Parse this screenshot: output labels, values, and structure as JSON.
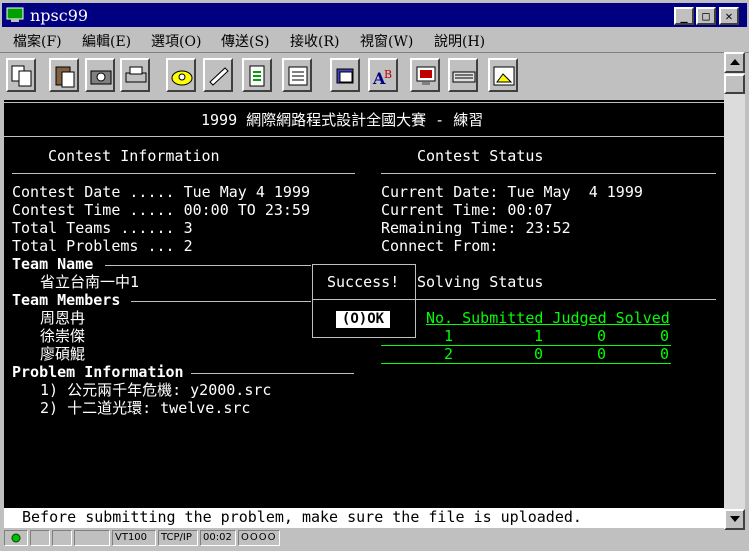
{
  "window": {
    "title": "npsc99"
  },
  "menu": [
    "檔案(F)",
    "編輯(E)",
    "選項(O)",
    "傳送(S)",
    "接收(R)",
    "視窗(W)",
    "說明(H)"
  ],
  "toolbar_icons": [
    "copy-icon",
    "paste-icon",
    "camera-icon",
    "print-icon",
    "phone-dial-icon",
    "hang-up-icon",
    "transfer-icon",
    "properties-icon",
    "send-file-icon",
    "receive-spell-icon",
    "monitor-icon",
    "keyboard-icon",
    "capture-icon"
  ],
  "terminal": {
    "header": "1999 網際網路程式設計全國大賽 - 練習",
    "contest_info": {
      "title": "Contest Information",
      "date": "Contest Date ..... Tue May 4 1999",
      "time": "Contest Time ..... 00:00 TO 23:59",
      "teams": "Total Teams ...... 3",
      "problems": "Total Problems ... 2"
    },
    "contest_status": {
      "title": "Contest Status",
      "current_date": "Current Date: Tue May  4 1999",
      "current_time": "Current Time: 00:07",
      "remaining": "Remaining Time: 23:52",
      "connect": "Connect From:"
    },
    "team_name_label": "Team Name",
    "team_name": "省立台南一中1",
    "team_members_label": "Team Members",
    "members": [
      "周恩冉",
      "徐崇傑",
      "廖碩鯤"
    ],
    "problem_info_label": "Problem Information",
    "problems": [
      "1) 公元兩千年危機: y2000.src",
      "2) 十二道光環: twelve.src"
    ],
    "solving_status_title": "Solving Status",
    "table_header": "No. Submitted Judged Solved",
    "table_rows": [
      {
        "no": "1",
        "submitted": "1",
        "judged": "0",
        "solved": "0"
      },
      {
        "no": "2",
        "submitted": "0",
        "judged": "0",
        "solved": "0"
      }
    ],
    "dialog": {
      "message": "Success!",
      "ok": "(O)OK"
    },
    "message": "Before submitting the problem, make sure the file is uploaded."
  },
  "status_bar": {
    "term": "VT100",
    "protocol": "TCP/IP",
    "time": "00:02",
    "leds": "OOOO"
  }
}
